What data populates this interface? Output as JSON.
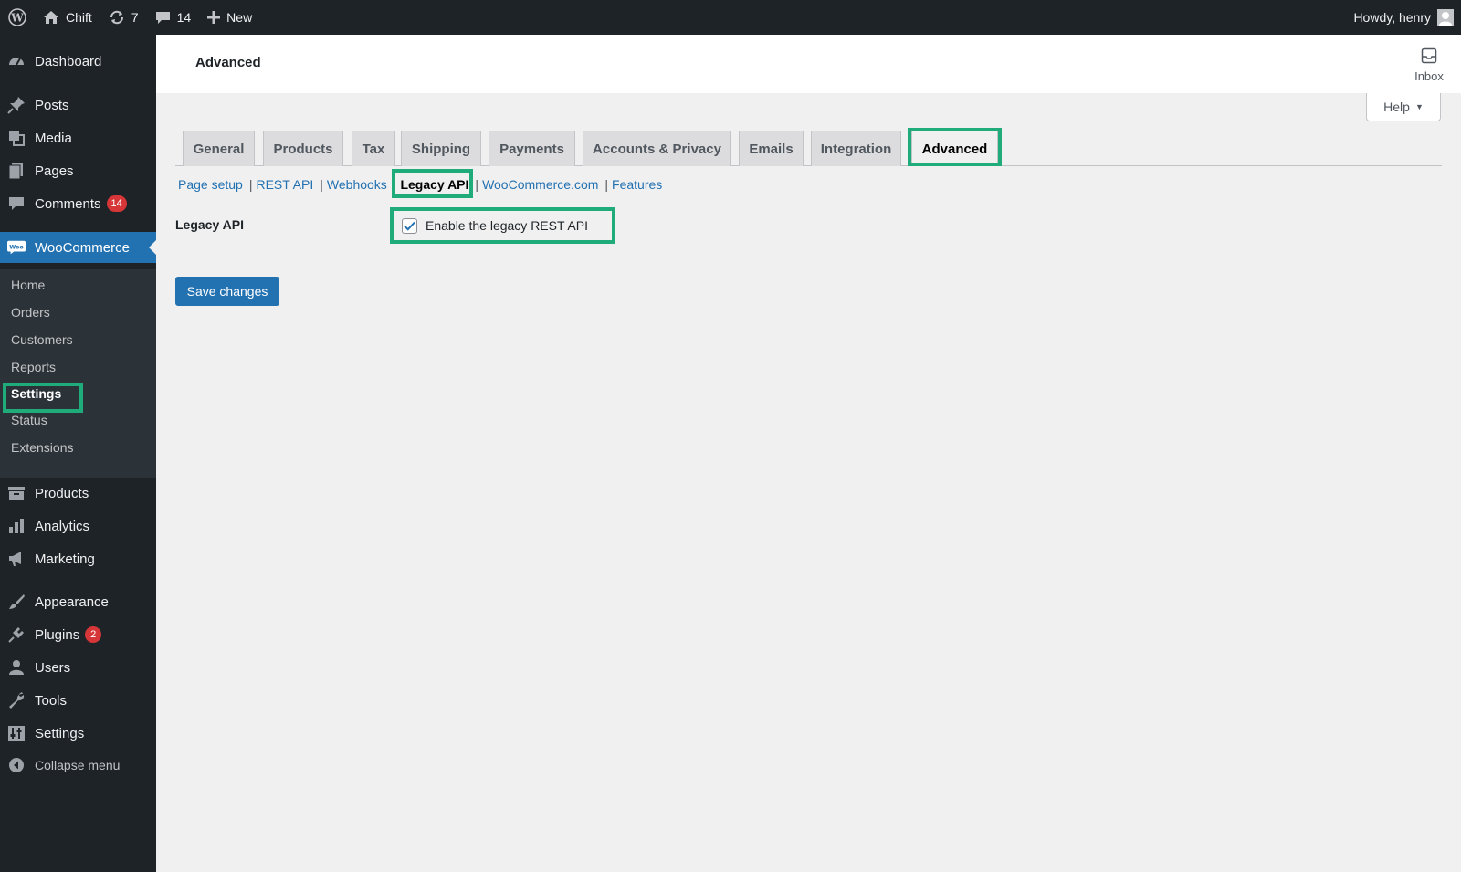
{
  "admin_bar": {
    "site_name": "Chift",
    "updates_count": "7",
    "comments_count": "14",
    "new_label": "New",
    "greeting": "Howdy, henry"
  },
  "sidebar": {
    "dashboard": "Dashboard",
    "posts": "Posts",
    "media": "Media",
    "pages": "Pages",
    "comments": "Comments",
    "comments_badge": "14",
    "woocommerce": "WooCommerce",
    "woo_submenu": {
      "home": "Home",
      "orders": "Orders",
      "customers": "Customers",
      "reports": "Reports",
      "settings": "Settings",
      "status": "Status",
      "extensions": "Extensions"
    },
    "products": "Products",
    "analytics": "Analytics",
    "marketing": "Marketing",
    "appearance": "Appearance",
    "plugins": "Plugins",
    "plugins_badge": "2",
    "users": "Users",
    "tools": "Tools",
    "settings": "Settings",
    "collapse": "Collapse menu"
  },
  "header": {
    "title": "Advanced",
    "inbox_label": "Inbox",
    "help_label": "Help"
  },
  "tabs": {
    "general": "General",
    "products": "Products",
    "tax": "Tax",
    "shipping": "Shipping",
    "payments": "Payments",
    "accounts": "Accounts & Privacy",
    "emails": "Emails",
    "integration": "Integration",
    "advanced": "Advanced"
  },
  "subnav": {
    "page_setup": "Page setup",
    "rest_api": "REST API",
    "webhooks": "Webhooks",
    "legacy_api": "Legacy API",
    "woocommerce_com": "WooCommerce.com",
    "features": "Features",
    "separator": "|"
  },
  "form": {
    "field_label": "Legacy API",
    "checkbox_label": "Enable the legacy REST API",
    "checkbox_checked": true,
    "save_label": "Save changes"
  },
  "colors": {
    "highlight": "#1fab7a",
    "primary": "#2271b1",
    "admin_dark": "#1d2327",
    "badge": "#d63638"
  }
}
